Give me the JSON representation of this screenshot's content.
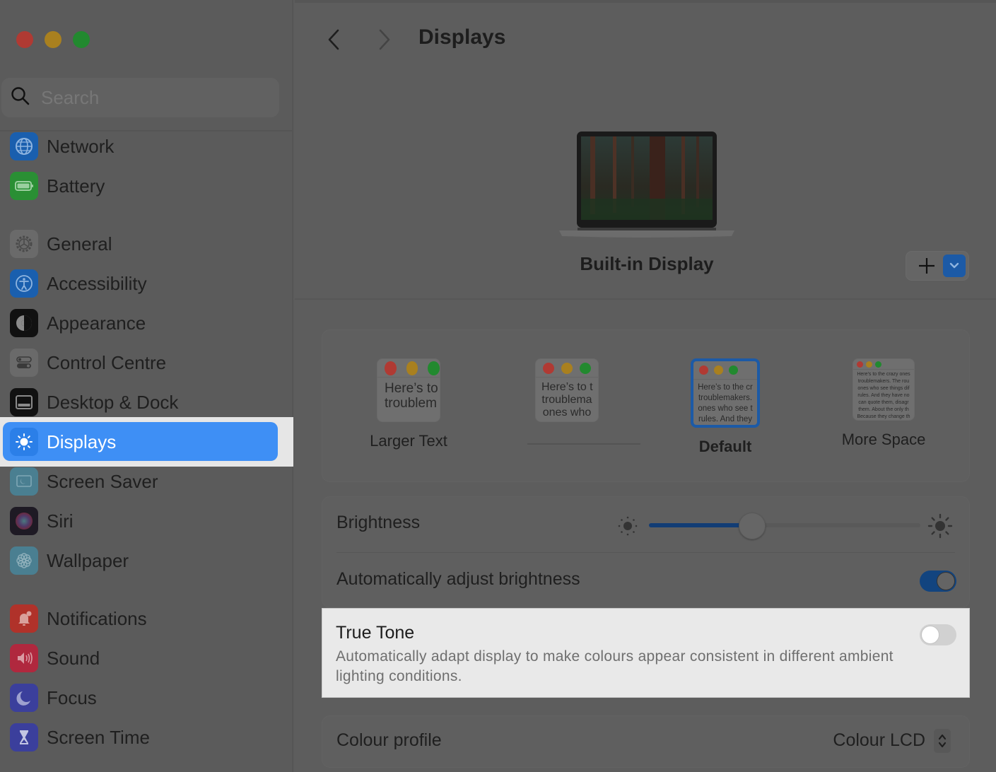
{
  "window": {
    "traffic_lights": [
      "close",
      "minimize",
      "zoom"
    ]
  },
  "sidebar": {
    "search_placeholder": "Search",
    "items": [
      {
        "label": "Network",
        "icon": "globe-icon",
        "color": "#1a5fae"
      },
      {
        "label": "Battery",
        "icon": "battery-icon",
        "color": "#2a8f34"
      },
      {
        "label": "General",
        "icon": "gear-icon",
        "color": "#6a6a6a"
      },
      {
        "label": "Accessibility",
        "icon": "accessibility-icon",
        "color": "#1a5fae"
      },
      {
        "label": "Appearance",
        "icon": "appearance-icon",
        "color": "#111111"
      },
      {
        "label": "Control Centre",
        "icon": "control-centre-icon",
        "color": "#6a6a6a"
      },
      {
        "label": "Desktop & Dock",
        "icon": "desktop-dock-icon",
        "color": "#111111"
      },
      {
        "label": "Displays",
        "icon": "sun-icon",
        "color": "#2b7fe8",
        "selected": true
      },
      {
        "label": "Screen Saver",
        "icon": "screen-saver-icon",
        "color": "#4a7f91"
      },
      {
        "label": "Siri",
        "icon": "siri-icon",
        "color": "#3a2a4a"
      },
      {
        "label": "Wallpaper",
        "icon": "wallpaper-icon",
        "color": "#4a7f91"
      },
      {
        "label": "Notifications",
        "icon": "bell-icon",
        "color": "#b0322a"
      },
      {
        "label": "Sound",
        "icon": "speaker-icon",
        "color": "#b0283e"
      },
      {
        "label": "Focus",
        "icon": "moon-icon",
        "color": "#3b3f9c"
      },
      {
        "label": "Screen Time",
        "icon": "hourglass-icon",
        "color": "#3b3f9c"
      }
    ]
  },
  "header": {
    "title": "Displays",
    "back_label": "Back",
    "forward_label": "Forward"
  },
  "display": {
    "name": "Built-in Display",
    "add_label": "+"
  },
  "resolution": {
    "options": [
      {
        "label": "Larger Text",
        "preview": "Here’s to\ntroublem",
        "selected": false
      },
      {
        "label": "",
        "preview": "Here’s to t\ntroublema\nones who",
        "selected": false
      },
      {
        "label": "Default",
        "preview": "Here’s to the cr\ntroublemakers.\nones who see t\nrules. And they",
        "selected": true
      },
      {
        "label": "More Space",
        "preview": "Here’s to the crazy ones\ntroublemakers. The rou\nones who see things dif\nrules. And they have no\ncan quote them, disagr\nthem. About the only th\nBecause they change th",
        "selected": false
      }
    ]
  },
  "brightness": {
    "label": "Brightness",
    "value_fraction": 0.38
  },
  "auto_brightness": {
    "label": "Automatically adjust brightness",
    "on": true
  },
  "true_tone": {
    "label": "True Tone",
    "description": "Automatically adapt display to make colours appear consistent in different ambient lighting conditions.",
    "on": false
  },
  "colour_profile": {
    "label": "Colour profile",
    "value": "Colour LCD"
  },
  "colors": {
    "accent": "#3e8ff5",
    "toggle_on": "#12447f",
    "highlight_bg": "#e9e9e9"
  }
}
